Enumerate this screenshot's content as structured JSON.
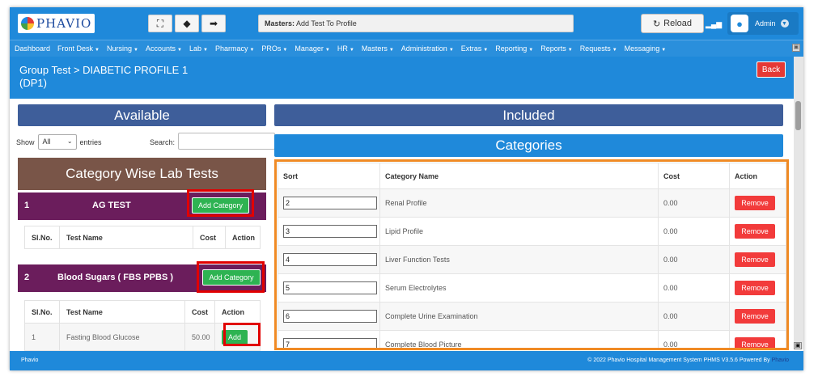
{
  "app": {
    "logo_text": "PHAVIO",
    "breadcrumb_label": "Masters:",
    "breadcrumb_value": "Add Test To Profile",
    "reload_label": "Reload",
    "user_label": "Admin"
  },
  "toolbar": {
    "expand_icon": "expand-icon",
    "back_icon": "arrow-left-icon",
    "forward_icon": "arrow-right-icon"
  },
  "nav": {
    "items": [
      "Dashboard",
      "Front Desk",
      "Nursing",
      "Accounts",
      "Lab",
      "Pharmacy",
      "PROs",
      "Manager",
      "HR",
      "Masters",
      "Administration",
      "Extras",
      "Reporting",
      "Reports",
      "Requests",
      "Messaging"
    ]
  },
  "page": {
    "title_line1": "Group Test > DIABETIC PROFILE 1",
    "title_line2": "(DP1)",
    "back_label": "Back"
  },
  "left": {
    "available_label": "Available",
    "show_label": "Show",
    "entries_select": "All",
    "entries_label": "entries",
    "search_label": "Search:",
    "category_header": "Category Wise Lab Tests",
    "categories": [
      {
        "num": "1",
        "name": "AG TEST",
        "button": "Add Category"
      },
      {
        "num": "2",
        "name": "Blood Sugars ( FBS PPBS )",
        "button": "Add Category"
      }
    ],
    "columns": [
      "Sl.No.",
      "Test Name",
      "Cost",
      "Action"
    ],
    "rows": [
      {
        "sl": "1",
        "name": "Fasting Blood Glucose",
        "cost": "50.00",
        "action": "Add"
      }
    ]
  },
  "right": {
    "included_label": "Included",
    "categories_label": "Categories",
    "columns": [
      "Sort",
      "Category Name",
      "Cost",
      "Action"
    ],
    "rows": [
      {
        "sort": "2",
        "name": "Renal Profile",
        "cost": "0.00",
        "action": "Remove"
      },
      {
        "sort": "3",
        "name": "Lipid Profile",
        "cost": "0.00",
        "action": "Remove"
      },
      {
        "sort": "4",
        "name": "Liver Function Tests",
        "cost": "0.00",
        "action": "Remove"
      },
      {
        "sort": "5",
        "name": "Serum Electrolytes",
        "cost": "0.00",
        "action": "Remove"
      },
      {
        "sort": "6",
        "name": "Complete Urine Examination",
        "cost": "0.00",
        "action": "Remove"
      },
      {
        "sort": "7",
        "name": "Complete Blood Picture",
        "cost": "0.00",
        "action": "Remove"
      }
    ]
  },
  "footer": {
    "left": "Phavio",
    "right": "© 2022 Phavio Hospital Management System PHMS V3.5.6 Powered By",
    "brand": "Phavio"
  },
  "colors": {
    "primary": "#1f89da",
    "available_bar": "#3e5e9a",
    "category_header": "#795548",
    "category_row": "#6b1d5c",
    "add": "#2eb352",
    "remove": "#f23b3b",
    "highlight_red": "#e10000",
    "highlight_orange": "#f08a24"
  }
}
